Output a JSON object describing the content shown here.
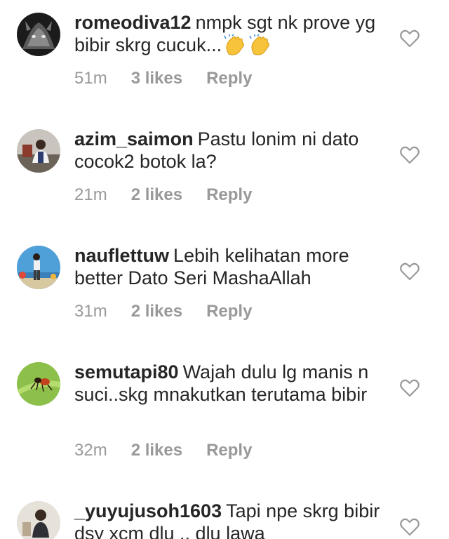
{
  "comments": [
    {
      "username": "romeodiva12",
      "text": "nmpk sgt nk prove yg bibir skrg cucuk...",
      "emoji": [
        "clapping-hands",
        "clapping-hands"
      ],
      "time": "51m",
      "likes": "3 likes",
      "reply": "Reply"
    },
    {
      "username": "azim_saimon",
      "text": "Pastu lonim ni dato cocok2 botok la?",
      "time": "21m",
      "likes": "2 likes",
      "reply": "Reply"
    },
    {
      "username": "nauflettuw",
      "text": "Lebih kelihatan more better Dato Seri MashaAllah",
      "time": "31m",
      "likes": "2 likes",
      "reply": "Reply"
    },
    {
      "username": "semutapi80",
      "text": "Wajah dulu lg manis n suci..skg mnakutkan terutama bibir",
      "time": "32m",
      "likes": "2 likes",
      "reply": "Reply"
    },
    {
      "username": "_yuyujusoh1603",
      "text": "Tapi npe skrg bibir dsy xcm dlu .. dlu lawa"
    }
  ],
  "icons": {
    "like": "heart-outline-icon"
  },
  "colors": {
    "text": "#262626",
    "meta": "#999999",
    "icon": "#999999"
  }
}
